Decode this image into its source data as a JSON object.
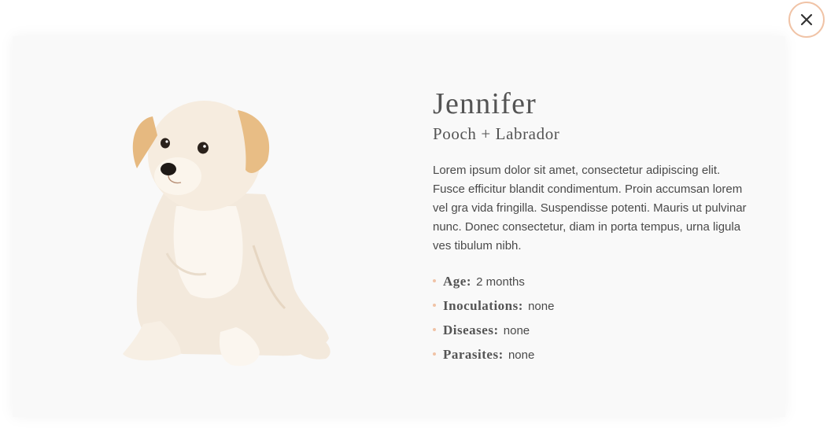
{
  "pet": {
    "name": "Jennifer",
    "breed": "Pooch + Labrador",
    "description": "Lorem ipsum dolor sit amet, consectetur adipiscing elit. Fusce efficitur blandit condimentum. Proin accumsan lorem vel gra vida fringilla. Suspendisse potenti. Mauris ut pulvinar nunc. Donec consectetur, diam in porta tempus, urna ligula ves tibulum nibh.",
    "details": [
      {
        "label": "Age:",
        "value": "2 months"
      },
      {
        "label": "Inoculations:",
        "value": "none"
      },
      {
        "label": "Diseases:",
        "value": "none"
      },
      {
        "label": "Parasites:",
        "value": "none"
      }
    ]
  },
  "icons": {
    "close": "close-icon",
    "bullet": "bullet-dot"
  },
  "colors": {
    "accent": "#f0c3a6",
    "modal_background": "#f9f9f9",
    "text": "#4a4a4a",
    "heading": "#545454"
  }
}
